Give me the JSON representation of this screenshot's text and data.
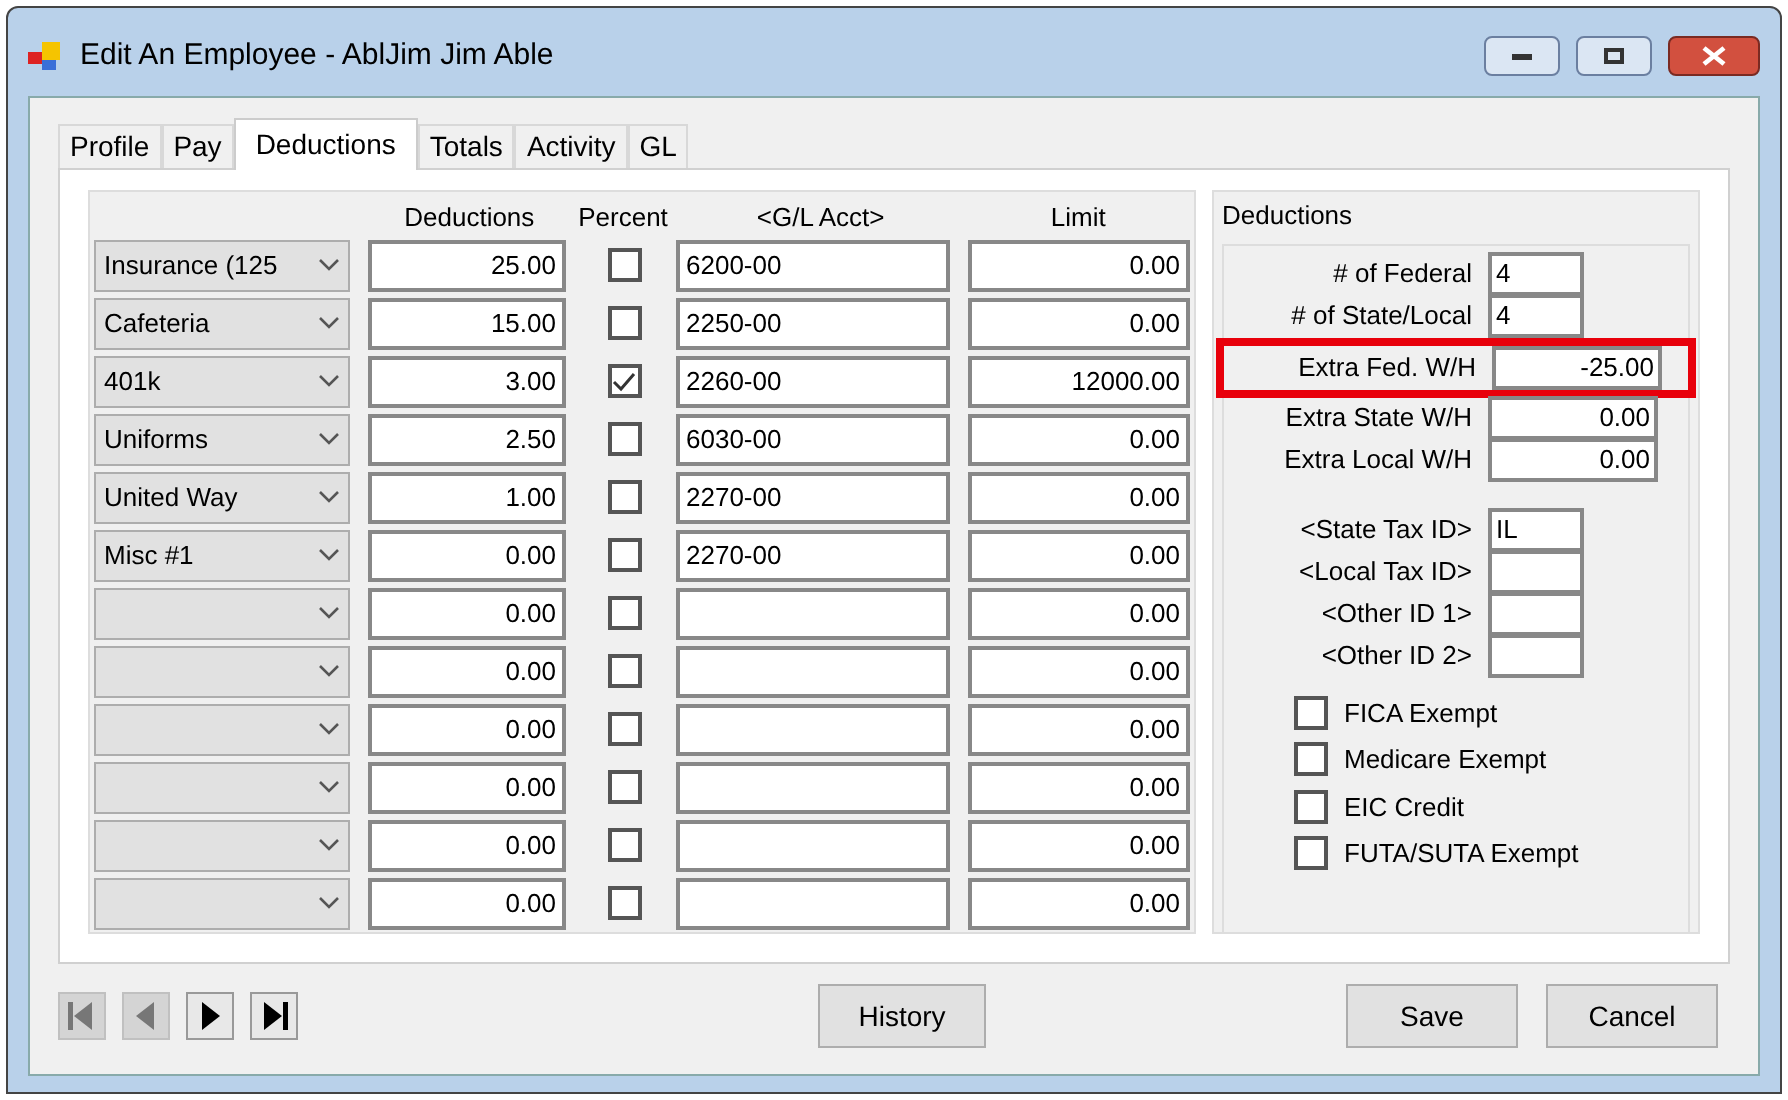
{
  "window": {
    "title": "Edit An Employee - AblJim Jim Able"
  },
  "tabs": [
    {
      "label": "Profile",
      "selected": false
    },
    {
      "label": "Pay",
      "selected": false
    },
    {
      "label": "Deductions",
      "selected": true
    },
    {
      "label": "Totals",
      "selected": false
    },
    {
      "label": "Activity",
      "selected": false
    },
    {
      "label": "GL",
      "selected": false
    }
  ],
  "table": {
    "columns": [
      "Deductions",
      "Percent",
      "<G/L Acct>",
      "Limit"
    ],
    "rows": [
      {
        "type": "Insurance (125",
        "amount": "25.00",
        "percent": false,
        "gl_acct": "6200-00",
        "limit": "0.00"
      },
      {
        "type": "Cafeteria",
        "amount": "15.00",
        "percent": false,
        "gl_acct": "2250-00",
        "limit": "0.00"
      },
      {
        "type": "401k",
        "amount": "3.00",
        "percent": true,
        "gl_acct": "2260-00",
        "limit": "12000.00"
      },
      {
        "type": "Uniforms",
        "amount": "2.50",
        "percent": false,
        "gl_acct": "6030-00",
        "limit": "0.00"
      },
      {
        "type": "United Way",
        "amount": "1.00",
        "percent": false,
        "gl_acct": "2270-00",
        "limit": "0.00"
      },
      {
        "type": "Misc #1",
        "amount": "0.00",
        "percent": false,
        "gl_acct": "2270-00",
        "limit": "0.00"
      },
      {
        "amount": "0.00",
        "percent": false,
        "limit": "0.00"
      },
      {
        "amount": "0.00",
        "percent": false,
        "limit": "0.00"
      },
      {
        "amount": "0.00",
        "percent": false,
        "limit": "0.00"
      },
      {
        "amount": "0.00",
        "percent": false,
        "limit": "0.00"
      },
      {
        "amount": "0.00",
        "percent": false,
        "limit": "0.00"
      },
      {
        "amount": "0.00",
        "percent": false,
        "limit": "0.00"
      }
    ]
  },
  "deductions_group": {
    "title": "Deductions",
    "fields": [
      {
        "label": "# of Federal",
        "value": "4",
        "kind": "short",
        "highlighted": false
      },
      {
        "label": "# of State/Local",
        "value": "4",
        "kind": "short",
        "highlighted": false
      },
      {
        "label": "Extra Fed. W/H",
        "value": "-25.00",
        "kind": "wide",
        "highlighted": true
      },
      {
        "label": "Extra State W/H",
        "value": "0.00",
        "kind": "wide",
        "highlighted": false
      },
      {
        "label": "Extra Local W/H",
        "value": "0.00",
        "kind": "wide",
        "highlighted": false
      },
      {
        "label": "<State Tax ID>",
        "value": "IL",
        "kind": "short",
        "highlighted": false
      },
      {
        "label": "<Local Tax ID>",
        "kind": "short",
        "highlighted": false
      },
      {
        "label": "<Other ID 1>",
        "kind": "short",
        "highlighted": false
      },
      {
        "label": "<Other ID 2>",
        "kind": "short",
        "highlighted": false
      }
    ],
    "checkboxes": [
      {
        "label": "FICA Exempt",
        "checked": false
      },
      {
        "label": "Medicare Exempt",
        "checked": false
      },
      {
        "label": "EIC Credit",
        "checked": false
      },
      {
        "label": "FUTA/SUTA Exempt",
        "checked": false
      }
    ]
  },
  "nav_buttons": [
    {
      "kind": "first",
      "disabled": true
    },
    {
      "kind": "prev",
      "disabled": true
    },
    {
      "kind": "next",
      "disabled": false
    },
    {
      "kind": "last",
      "disabled": false
    }
  ],
  "buttons": {
    "history": "History",
    "save": "Save",
    "cancel": "Cancel"
  }
}
